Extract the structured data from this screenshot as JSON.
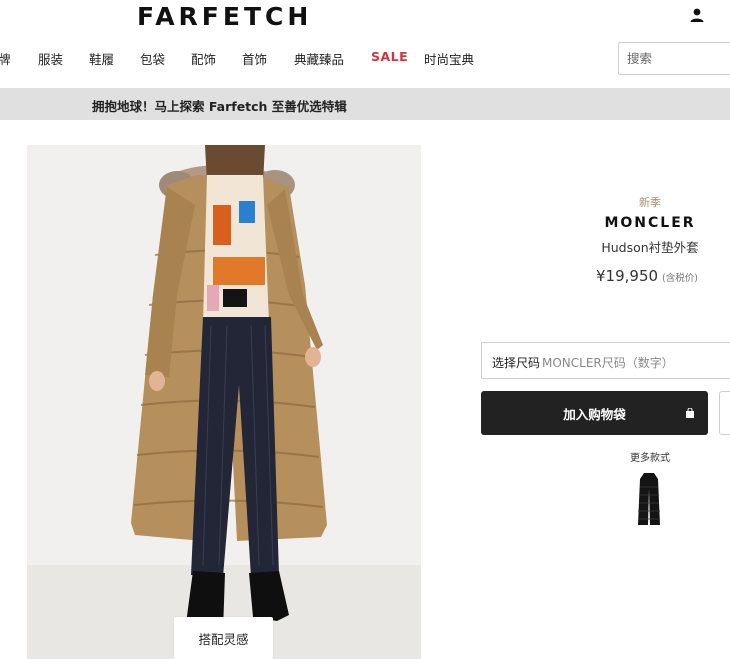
{
  "header": {
    "logo": "FARFETCH",
    "account_icon": "user-icon"
  },
  "nav": {
    "items": [
      {
        "label": "牌"
      },
      {
        "label": "服装"
      },
      {
        "label": "鞋履"
      },
      {
        "label": "包袋"
      },
      {
        "label": "配饰"
      },
      {
        "label": "首饰"
      },
      {
        "label": "典藏臻品"
      },
      {
        "label": "SALE"
      },
      {
        "label": "时尚宝典"
      }
    ],
    "sale_color": "#d1353c"
  },
  "search": {
    "placeholder": "搜索"
  },
  "banner": {
    "text": "拥抱地球！马上探索 Farfetch 至善优选特辑"
  },
  "gallery": {
    "style_button": "搭配灵感"
  },
  "product": {
    "badge": "新季",
    "brand": "MONCLER",
    "name": "Hudson衬垫外套",
    "price": "¥19,950",
    "price_note": "(含税价)"
  },
  "size_selector": {
    "label": "选择尺码",
    "value": "MONCLER尺码（数字）"
  },
  "actions": {
    "add_to_bag": "加入购物袋",
    "bag_icon": "shopping-bag-icon",
    "wishlist_icon": "heart-icon"
  },
  "more_styles": {
    "label": "更多款式"
  },
  "colors": {
    "button_dark": "#222222",
    "banner_bg": "#e0e0e0",
    "badge": "#a8926a"
  }
}
